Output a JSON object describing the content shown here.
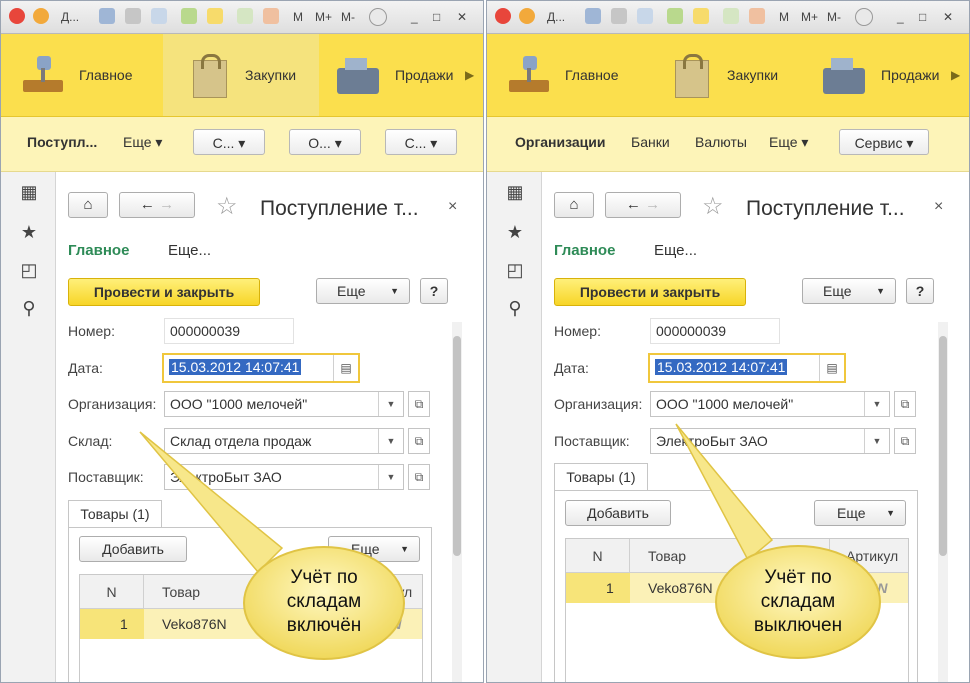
{
  "left": {
    "titlebar": {
      "title": "Д...",
      "items": [
        "M",
        "M+",
        "M-"
      ]
    },
    "sections": [
      {
        "label": "Главное",
        "icon": "desk-lamp-icon"
      },
      {
        "label": "Закупки",
        "icon": "shopping-bag-icon"
      },
      {
        "label": "Продажи",
        "icon": "cash-register-icon"
      }
    ],
    "command_bar": {
      "active_item": "Поступл...",
      "more": "Еще ▾",
      "dropdowns": [
        "С... ▾",
        "О... ▾",
        "С... ▾"
      ]
    },
    "form": {
      "title": "Поступление т...",
      "tabs": [
        "Главное",
        "Еще..."
      ],
      "post_button": "Провести и закрыть",
      "more_button": "Еще",
      "help_button": "?",
      "fields": [
        {
          "label": "Номер:",
          "value": "000000039"
        },
        {
          "label": "Дата:",
          "value": "15.03.2012 14:07:41"
        },
        {
          "label": "Организация:",
          "value": "ООО \"1000 мелочей\""
        },
        {
          "label": "Склад:",
          "value": "Склад отдела продаж"
        },
        {
          "label": "Поставщик:",
          "value": "ЭлектроБыт ЗАО"
        }
      ],
      "goods_tab": "Товары (1)",
      "add_button": "Добавить",
      "more_button_table": "Еще",
      "table": {
        "columns": [
          "N",
          "Товар",
          "Артикул"
        ],
        "rows": [
          {
            "n": "1",
            "product": "Veko876N",
            "article": "876N"
          }
        ]
      }
    },
    "callout": "Учёт по складам включён"
  },
  "right": {
    "titlebar": {
      "title": "Д...",
      "items": [
        "M",
        "M+",
        "M-"
      ]
    },
    "sections": [
      {
        "label": "Главное",
        "icon": "desk-lamp-icon"
      },
      {
        "label": "Закупки",
        "icon": "shopping-bag-icon"
      },
      {
        "label": "Продажи",
        "icon": "cash-register-icon"
      }
    ],
    "command_bar": {
      "items": [
        "Организации",
        "Банки",
        "Валюты"
      ],
      "more": "Еще ▾",
      "service": "Сервис ▾"
    },
    "form": {
      "title": "Поступление т...",
      "tabs": [
        "Главное",
        "Еще..."
      ],
      "post_button": "Провести и закрыть",
      "more_button": "Еще",
      "help_button": "?",
      "fields": [
        {
          "label": "Номер:",
          "value": "000000039"
        },
        {
          "label": "Дата:",
          "value": "15.03.2012 14:07:41"
        },
        {
          "label": "Организация:",
          "value": "ООО \"1000 мелочей\""
        },
        {
          "label": "Поставщик:",
          "value": "ЭлектроБыт ЗАО"
        }
      ],
      "goods_tab": "Товары (1)",
      "add_button": "Добавить",
      "more_button_table": "Еще",
      "table": {
        "columns": [
          "N",
          "Товар",
          "Артикул"
        ],
        "rows": [
          {
            "n": "1",
            "product": "Veko876N",
            "article": "876N"
          }
        ]
      }
    },
    "callout": "Учёт по складам выключен"
  },
  "colors": {
    "accent_yellow": "#fbdf4d",
    "active_tab_green": "#2e8b57",
    "selection_blue": "#3469c2"
  }
}
